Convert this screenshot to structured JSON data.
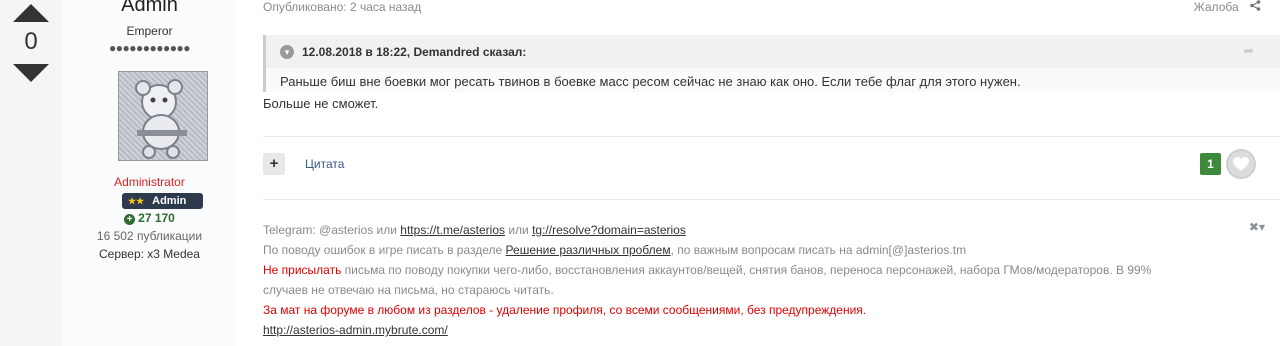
{
  "vote": {
    "count": "0"
  },
  "author": {
    "name": "Admin",
    "title": "Emperor",
    "pips": "●●●●●●●●●●●●",
    "group": "Administrator",
    "badge": {
      "stars": "★★",
      "label": "Admin"
    },
    "reputation": "27 170",
    "posts": "16 502 публикации",
    "server": "Сервер: x3 Medea"
  },
  "post": {
    "published": "Опубликовано: 2 часа назад",
    "report": "Жалоба",
    "quote": {
      "author": "12.08.2018 в 18:22, Demandred сказал:",
      "text": "Раньше биш вне боевки мог ресать твинов в боевке масс ресом сейчас не знаю как оно. Если тебе флаг для этого нужен."
    },
    "body": "Больше не сможет.",
    "actions": {
      "multiquote": "+",
      "quote": "Цитата",
      "likes": "1"
    }
  },
  "signature": {
    "l1": {
      "a": "Telegram: @asterios или ",
      "b": "https://t.me/asterios",
      "c": " или ",
      "d": "tg://resolve?domain=asterios"
    },
    "l2": {
      "a": "По поводу ошибок в игре писать в разделе ",
      "b": "Решение различных проблем",
      "c": ", по важным вопросам писать на admin[@]asterios.tm"
    },
    "l3": {
      "a": "Не присылать",
      "b": " письма по поводу покупки чего-либо, восстановления аккаунтов/вещей, снятия банов, переноса персонажей, набора ГМов/модераторов. В 99%"
    },
    "l4": "случаев не отвечаю на письма, но стараюсь читать.",
    "l5": "За мат на форуме в любом из разделов - удаление профиля, со всеми сообщениями, без предупреждения.",
    "l6": "http://asterios-admin.mybrute.com/"
  },
  "colors": {
    "red": "#e00000",
    "badge": "#2d3a4e",
    "rep": "#2e6b2e",
    "like": "#3d8a3d"
  },
  "icons": [
    "vote-up-icon",
    "vote-down-icon",
    "share-icon",
    "collapse-icon",
    "quote-share-icon",
    "heart-icon",
    "close-icon",
    "chevron-down-icon"
  ]
}
